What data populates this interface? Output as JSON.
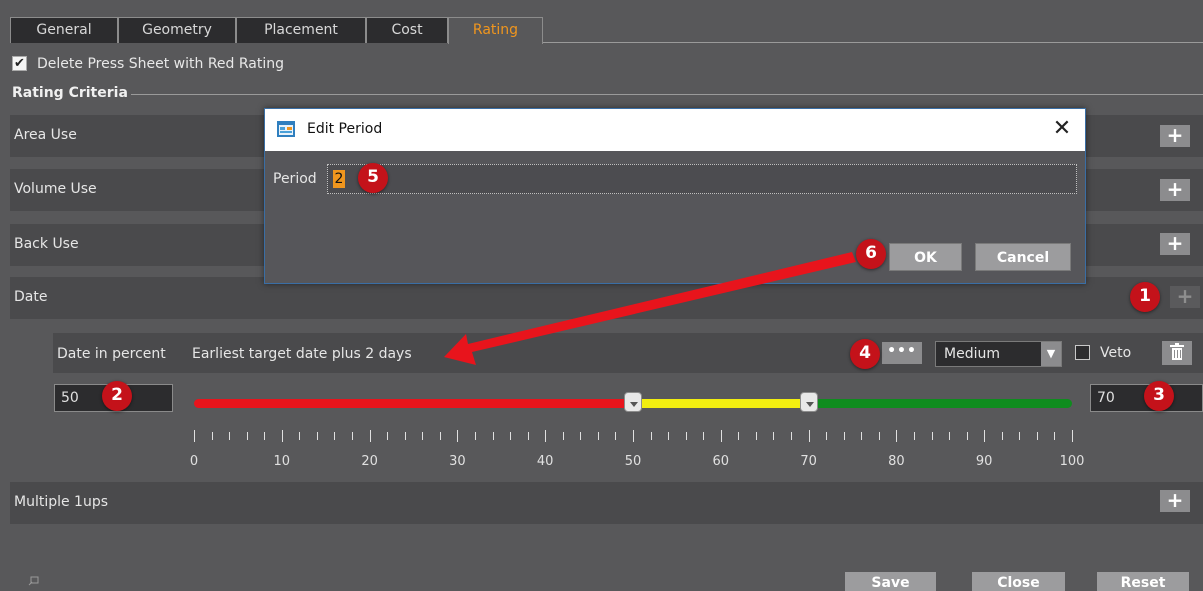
{
  "tabs": [
    "General",
    "Geometry",
    "Placement",
    "Cost",
    "Rating"
  ],
  "active_tab": "Rating",
  "delete_option": {
    "label": "Delete Press Sheet with Red Rating",
    "checked": true
  },
  "section_title": "Rating Criteria",
  "criteria": [
    "Area Use",
    "Volume Use",
    "Back Use",
    "Date",
    "Multiple 1ups"
  ],
  "date_rule": {
    "type_label": "Date in percent",
    "description": "Earliest target date plus 2 days",
    "priority": "Medium",
    "veto_label": "Veto",
    "veto_checked": false,
    "lower_value": "50",
    "upper_value": "70",
    "scale_labels": [
      "0",
      "10",
      "20",
      "30",
      "40",
      "50",
      "60",
      "70",
      "80",
      "90",
      "100"
    ],
    "thresholds": {
      "red_to": 50,
      "yellow_to": 70,
      "max": 100
    },
    "colors": {
      "red": "#e8141c",
      "yellow": "#f2ee10",
      "green": "#0f8c1e"
    }
  },
  "footer": {
    "save": "Save",
    "close": "Close",
    "reset": "Reset"
  },
  "dialog": {
    "title": "Edit Period",
    "period_label": "Period",
    "period_value": "2",
    "ok": "OK",
    "cancel": "Cancel"
  },
  "callouts": [
    "1",
    "2",
    "3",
    "4",
    "5",
    "6"
  ],
  "accent_color": "#f0961e",
  "callout_color": "#c4121a"
}
